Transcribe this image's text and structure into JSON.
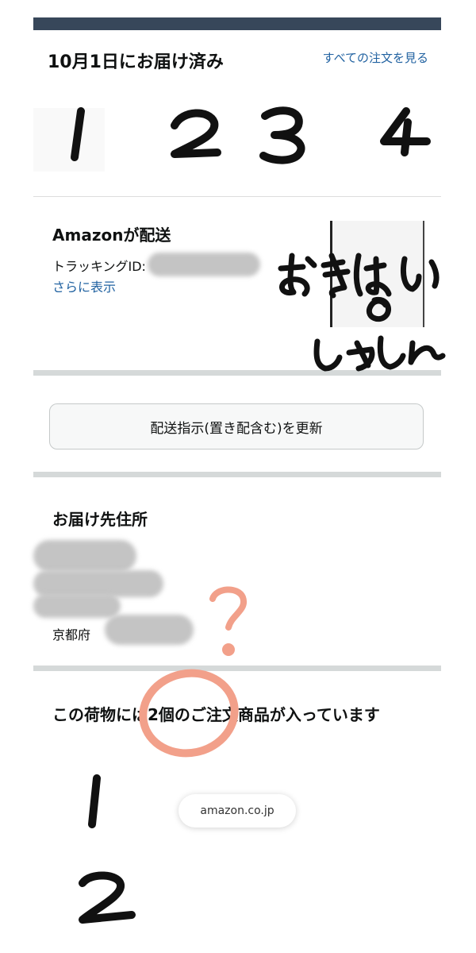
{
  "header": {
    "delivery_status": "10月1日にお届け済み",
    "view_all_orders": "すべての注文を見る"
  },
  "shipping": {
    "title": "Amazonが配送",
    "tracking_label": "トラッキングID:",
    "show_more": "さらに表示"
  },
  "delivery_instruction_button": "配送指示(置き配含む)を更新",
  "address": {
    "title": "お届け先住所",
    "prefecture": "京都府"
  },
  "package": {
    "title": "この荷物には2個のご注文商品が入っています"
  },
  "toast": {
    "domain": "amazon.co.jp"
  },
  "handwriting": {
    "top_numbers": [
      "1",
      "2",
      "3",
      "4"
    ],
    "photo_note": "おきはいのしゃしん",
    "question_mark": "?",
    "item_numbers": [
      "1",
      "2"
    ]
  },
  "colors": {
    "top_bar": "#37475a",
    "link": "#2162a1",
    "divider": "#d5d9d9",
    "circle_annotation": "#f2a08a",
    "ink": "#111111"
  }
}
